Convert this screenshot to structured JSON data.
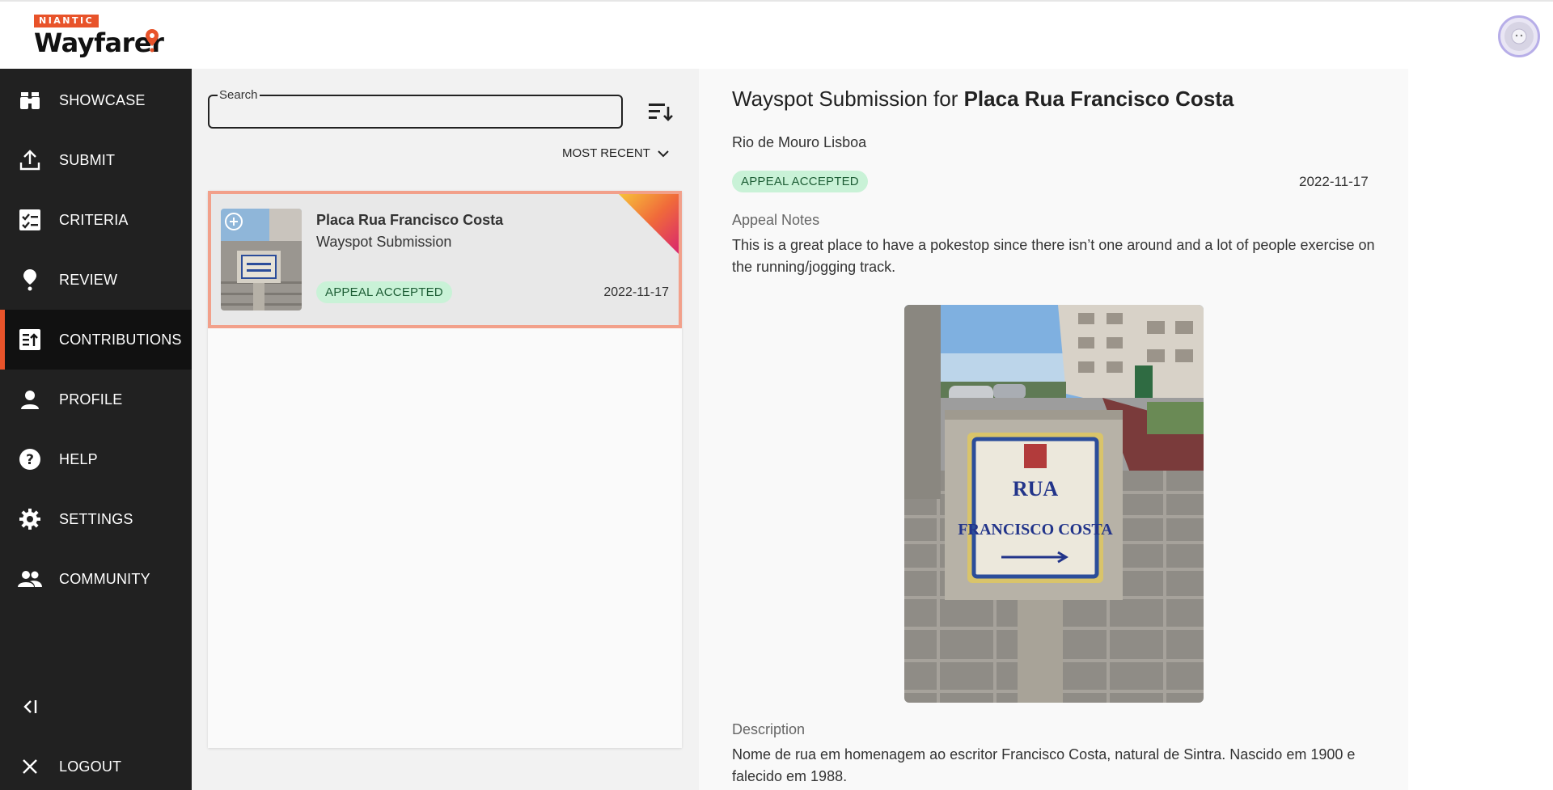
{
  "header": {
    "brand_badge": "NIANTIC",
    "brand_name": "Wayfarer"
  },
  "sidebar": {
    "items": [
      {
        "label": "SHOWCASE",
        "icon": "binoculars-icon"
      },
      {
        "label": "SUBMIT",
        "icon": "upload-icon"
      },
      {
        "label": "CRITERIA",
        "icon": "checklist-icon"
      },
      {
        "label": "REVIEW",
        "icon": "pin-icon"
      },
      {
        "label": "CONTRIBUTIONS",
        "icon": "contributions-icon",
        "active": true
      },
      {
        "label": "PROFILE",
        "icon": "person-icon"
      },
      {
        "label": "HELP",
        "icon": "help-icon"
      },
      {
        "label": "SETTINGS",
        "icon": "gear-icon"
      },
      {
        "label": "COMMUNITY",
        "icon": "group-icon"
      }
    ],
    "collapse_icon": "collapse-icon",
    "logout_label": "LOGOUT"
  },
  "list": {
    "search_legend": "Search",
    "search_value": "",
    "sort_label": "MOST RECENT",
    "cards": [
      {
        "title": "Placa Rua Francisco Costa",
        "type": "Wayspot Submission",
        "status": "APPEAL ACCEPTED",
        "date": "2022-11-17"
      }
    ]
  },
  "detail": {
    "title_prefix": "Wayspot Submission for ",
    "title_name": "Placa Rua Francisco Costa",
    "location": "Rio de Mouro Lisboa",
    "status": "APPEAL ACCEPTED",
    "date": "2022-11-17",
    "appeal_label": "Appeal Notes",
    "appeal_text": "This is a great place to have a pokestop since there isn’t one around and a lot of people exercise on the running/jogging track.",
    "description_label": "Description",
    "description_text": "Nome de rua em homenagem ao escritor Francisco Costa, natural de Sintra. Nascido em 1900 e falecido em 1988.",
    "sign_line1": "RUA",
    "sign_line2": "FRANCISCO COSTA"
  },
  "colors": {
    "accent": "#e8532a",
    "sidebar_bg": "#212121",
    "badge_bg": "#c9f2d7",
    "badge_text": "#1e5e36",
    "card_border": "#f2a08a"
  }
}
